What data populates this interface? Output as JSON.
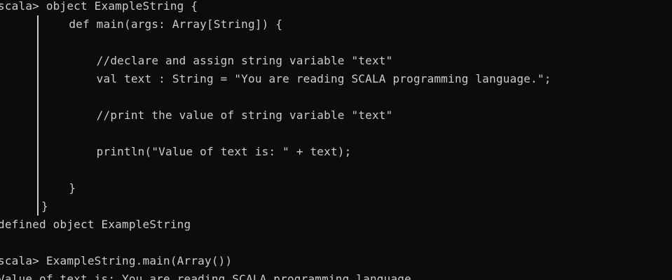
{
  "terminal": {
    "lines": [
      {
        "kind": "prompt",
        "text": "scala> object ExampleString {"
      },
      {
        "kind": "cont",
        "text": "    def main(args: Array[String]) {"
      },
      {
        "kind": "cont",
        "text": ""
      },
      {
        "kind": "cont",
        "text": "        //declare and assign string variable \"text\""
      },
      {
        "kind": "cont",
        "text": "        val text : String = \"You are reading SCALA programming language.\";"
      },
      {
        "kind": "cont",
        "text": ""
      },
      {
        "kind": "cont",
        "text": "        //print the value of string variable \"text\""
      },
      {
        "kind": "cont",
        "text": ""
      },
      {
        "kind": "cont",
        "text": "        println(\"Value of text is: \" + text);"
      },
      {
        "kind": "cont",
        "text": ""
      },
      {
        "kind": "cont",
        "text": "    }"
      },
      {
        "kind": "cont",
        "text": "}"
      },
      {
        "kind": "output",
        "text": "defined object ExampleString"
      },
      {
        "kind": "output",
        "text": ""
      },
      {
        "kind": "prompt",
        "text": "scala> ExampleString.main(Array())"
      },
      {
        "kind": "output",
        "text": "Value of text is: You are reading SCALA programming language."
      }
    ]
  },
  "colors": {
    "background": "#0c0c0c",
    "foreground": "#cccccc"
  }
}
